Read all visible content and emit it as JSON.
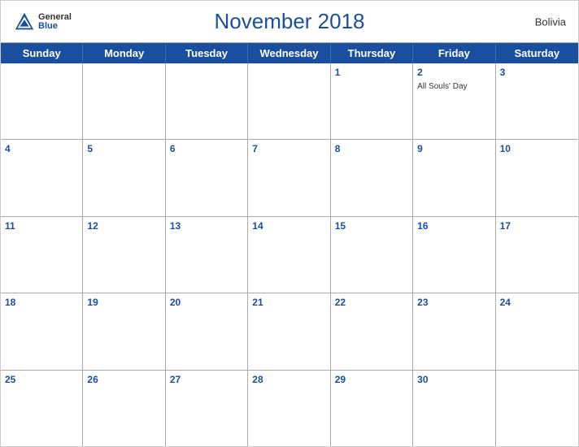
{
  "header": {
    "title": "November 2018",
    "country": "Bolivia",
    "logo": {
      "line1": "General",
      "line2": "Blue"
    }
  },
  "dayHeaders": [
    "Sunday",
    "Monday",
    "Tuesday",
    "Wednesday",
    "Thursday",
    "Friday",
    "Saturday"
  ],
  "weeks": [
    [
      {
        "date": "",
        "holiday": ""
      },
      {
        "date": "",
        "holiday": ""
      },
      {
        "date": "",
        "holiday": ""
      },
      {
        "date": "",
        "holiday": ""
      },
      {
        "date": "1",
        "holiday": ""
      },
      {
        "date": "2",
        "holiday": "All Souls' Day"
      },
      {
        "date": "3",
        "holiday": ""
      }
    ],
    [
      {
        "date": "4",
        "holiday": ""
      },
      {
        "date": "5",
        "holiday": ""
      },
      {
        "date": "6",
        "holiday": ""
      },
      {
        "date": "7",
        "holiday": ""
      },
      {
        "date": "8",
        "holiday": ""
      },
      {
        "date": "9",
        "holiday": ""
      },
      {
        "date": "10",
        "holiday": ""
      }
    ],
    [
      {
        "date": "11",
        "holiday": ""
      },
      {
        "date": "12",
        "holiday": ""
      },
      {
        "date": "13",
        "holiday": ""
      },
      {
        "date": "14",
        "holiday": ""
      },
      {
        "date": "15",
        "holiday": ""
      },
      {
        "date": "16",
        "holiday": ""
      },
      {
        "date": "17",
        "holiday": ""
      }
    ],
    [
      {
        "date": "18",
        "holiday": ""
      },
      {
        "date": "19",
        "holiday": ""
      },
      {
        "date": "20",
        "holiday": ""
      },
      {
        "date": "21",
        "holiday": ""
      },
      {
        "date": "22",
        "holiday": ""
      },
      {
        "date": "23",
        "holiday": ""
      },
      {
        "date": "24",
        "holiday": ""
      }
    ],
    [
      {
        "date": "25",
        "holiday": ""
      },
      {
        "date": "26",
        "holiday": ""
      },
      {
        "date": "27",
        "holiday": ""
      },
      {
        "date": "28",
        "holiday": ""
      },
      {
        "date": "29",
        "holiday": ""
      },
      {
        "date": "30",
        "holiday": ""
      },
      {
        "date": "",
        "holiday": ""
      }
    ]
  ],
  "colors": {
    "headerBlue": "#1a4fa0",
    "textBlue": "#1a4fa0"
  }
}
